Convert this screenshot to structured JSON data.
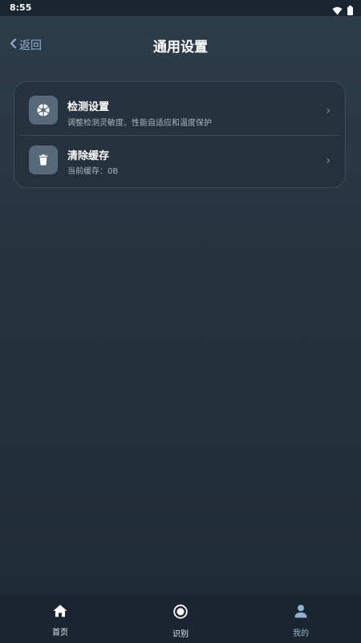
{
  "status_bar": {
    "time": "8:55",
    "icons": [
      "wifi-icon",
      "battery-icon"
    ]
  },
  "header": {
    "back_label": "返回",
    "title": "通用设置"
  },
  "settings": {
    "items": [
      {
        "icon": "aperture-icon",
        "title": "检测设置",
        "subtitle": "调整检测灵敏度、性能自适应和温度保护",
        "chevron": "›"
      },
      {
        "icon": "trash-icon",
        "title": "清除缓存",
        "subtitle": "当前缓存：0B",
        "chevron": "›"
      }
    ]
  },
  "bottom_nav": {
    "items": [
      {
        "icon": "home-icon",
        "label": "首页"
      },
      {
        "icon": "record-icon",
        "label": "识别"
      },
      {
        "icon": "user-icon",
        "label": "我的",
        "active": true
      }
    ]
  },
  "colors": {
    "accent": "#8fb3d1",
    "background_top": "#2e3d4b",
    "background_bottom": "#1f2a35",
    "icon_tile": "#56687a"
  }
}
